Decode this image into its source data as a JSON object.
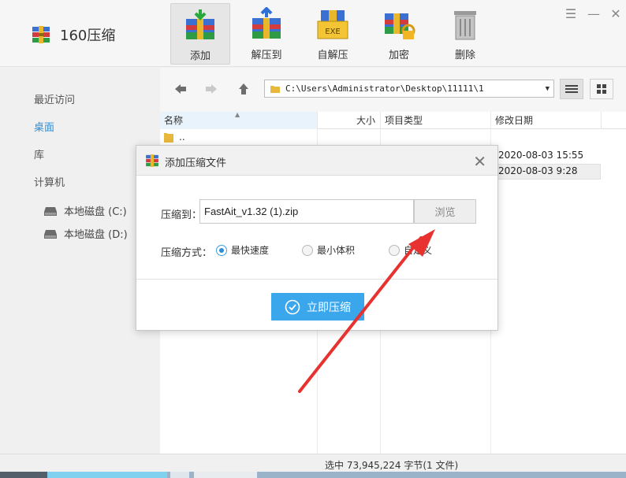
{
  "app": {
    "title": "160压缩"
  },
  "toolbar": [
    {
      "label": "添加",
      "icon": "add-archive-icon",
      "active": true
    },
    {
      "label": "解压到",
      "icon": "extract-to-icon",
      "active": false
    },
    {
      "label": "自解压",
      "icon": "self-extract-exe-icon",
      "active": false
    },
    {
      "label": "加密",
      "icon": "encrypt-lock-icon",
      "active": false
    },
    {
      "label": "删除",
      "icon": "trash-icon",
      "active": false
    }
  ],
  "exe_badge": "EXE",
  "sidebar": {
    "items": [
      "最近访问",
      "桌面",
      "库",
      "计算机"
    ],
    "selected": "桌面",
    "drives": [
      "本地磁盘 (C:)",
      "本地磁盘 (D:)"
    ]
  },
  "path": "C:\\Users\\Administrator\\Desktop\\11111\\1",
  "columns": [
    "名称",
    "大小",
    "项目类型",
    "修改日期"
  ],
  "files": {
    "up_label": "..",
    "dates": [
      "2020-08-03 15:55",
      "2020-08-03 9:28"
    ]
  },
  "status": "选中 73,945,224 字节(1 文件)",
  "dialog": {
    "title": "添加压缩文件",
    "to_label": "压缩到：",
    "filename": "FastAit_v1.32 (1).zip",
    "browse": "浏览",
    "mode_label": "压缩方式：",
    "modes": [
      "最快速度",
      "最小体积",
      "自定义"
    ],
    "mode_selected": "最快速度",
    "submit": "立即压缩"
  },
  "colors": {
    "accent": "#3aa6ec",
    "selected_nav": "#2c8dd8",
    "arrow": "#e8322f"
  }
}
